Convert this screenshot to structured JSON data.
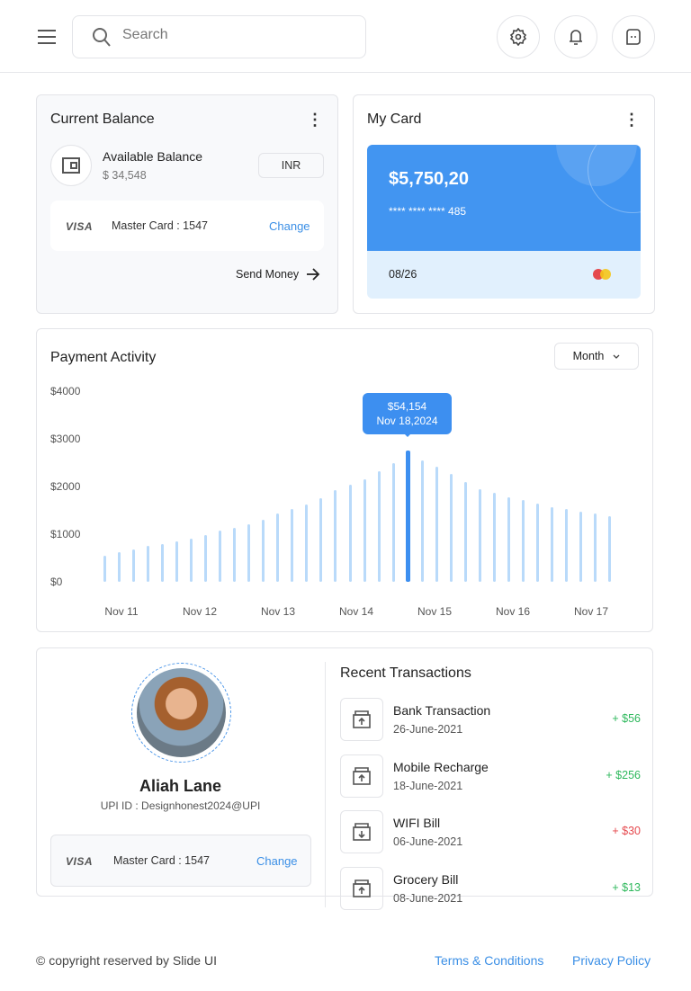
{
  "header": {
    "search_placeholder": "Search",
    "icons": [
      "menu-icon",
      "search-icon",
      "gear-icon",
      "bell-icon",
      "chat-icon"
    ]
  },
  "balance": {
    "title": "Current Balance",
    "label": "Available Balance",
    "amount": "$ 34,548",
    "currency": "INR",
    "card_brand": "VISA",
    "card_text": "Master Card : 1547",
    "change": "Change",
    "send": "Send Money"
  },
  "my_card": {
    "title": "My Card",
    "amount": "$5,750,20",
    "number": "**** **** **** 485",
    "expiry": "08/26",
    "colors": {
      "card": "#4295f1",
      "footer": "#e1f0fd"
    }
  },
  "activity": {
    "title": "Payment Activity",
    "period": "Month"
  },
  "chart_data": {
    "type": "bar",
    "ylim": [
      0,
      4000
    ],
    "yticks": [
      "$4000",
      "$3000",
      "$2000",
      "$1000",
      "$0"
    ],
    "xticks": [
      "Nov 11",
      "Nov 12",
      "Nov 13",
      "Nov 14",
      "Nov 15",
      "Nov 16",
      "Nov 17"
    ],
    "values": [
      550,
      630,
      670,
      750,
      800,
      840,
      900,
      990,
      1070,
      1130,
      1200,
      1300,
      1440,
      1530,
      1630,
      1760,
      1920,
      2030,
      2150,
      2320,
      2490,
      2760,
      2550,
      2410,
      2260,
      2090,
      1950,
      1860,
      1780,
      1720,
      1650,
      1560,
      1530,
      1470,
      1440,
      1380
    ],
    "highlight_index": 21,
    "tooltip": {
      "value": "$54,154",
      "date": "Nov 18,2024"
    },
    "colors": {
      "bar": "#b9dafa",
      "highlight": "#3d8ff0"
    }
  },
  "profile": {
    "name": "Aliah Lane",
    "upi": "UPI ID : Designhonest2024@UPI",
    "card_brand": "VISA",
    "card_text": "Master Card : 1547",
    "change": "Change"
  },
  "transactions": {
    "title": "Recent Transactions",
    "items": [
      {
        "name": "Bank Transaction",
        "date": "26-June-2021",
        "amount": "+ $56",
        "type": "credit"
      },
      {
        "name": "Mobile Recharge",
        "date": "18-June-2021",
        "amount": "+ $256",
        "type": "credit"
      },
      {
        "name": "WIFI Bill",
        "date": "06-June-2021",
        "amount": "+ $30",
        "type": "debit"
      },
      {
        "name": "Grocery Bill",
        "date": "08-June-2021",
        "amount": "+ $13",
        "type": "credit"
      }
    ],
    "colors": {
      "credit": "#2eb85c",
      "debit": "#e5484d"
    }
  },
  "footer": {
    "copyright": "© copyright reserved by Slide UI",
    "terms": "Terms & Conditions",
    "privacy": "Privacy Policy"
  }
}
